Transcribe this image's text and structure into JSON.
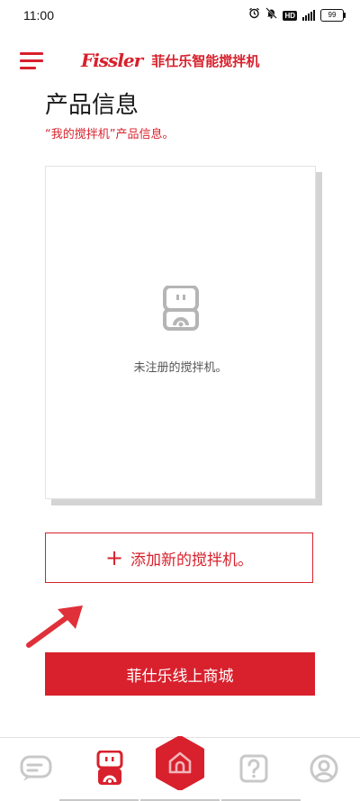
{
  "status_bar": {
    "time": "11:00",
    "battery": "99",
    "icons": [
      "alarm-icon",
      "mute-icon",
      "hd-icon",
      "signal-icon",
      "battery-icon"
    ],
    "hd_label": "HD"
  },
  "header": {
    "logo_text": "Fissler",
    "brand_name": "菲仕乐智能搅拌机",
    "menu_icon": "hamburger-menu-icon"
  },
  "page": {
    "title": "产品信息",
    "subtitle": "“我的搅拌机”产品信息。"
  },
  "product_card": {
    "icon": "blender-icon",
    "message": "未注册的搅拌机。"
  },
  "add_button": {
    "icon": "plus-icon",
    "label": "添加新的搅拌机。"
  },
  "shop_button": {
    "label": "菲仕乐线上商城"
  },
  "bottom_nav": {
    "items": [
      {
        "icon": "chat-icon",
        "active": false
      },
      {
        "icon": "blender-icon",
        "active": true
      },
      {
        "icon": "home-icon",
        "active": false,
        "highlight": true
      },
      {
        "icon": "help-icon",
        "active": false
      },
      {
        "icon": "profile-icon",
        "active": false
      }
    ]
  },
  "colors": {
    "accent": "#d8212d",
    "inactive": "#c8c8c8",
    "text": "#1a1a1a"
  }
}
